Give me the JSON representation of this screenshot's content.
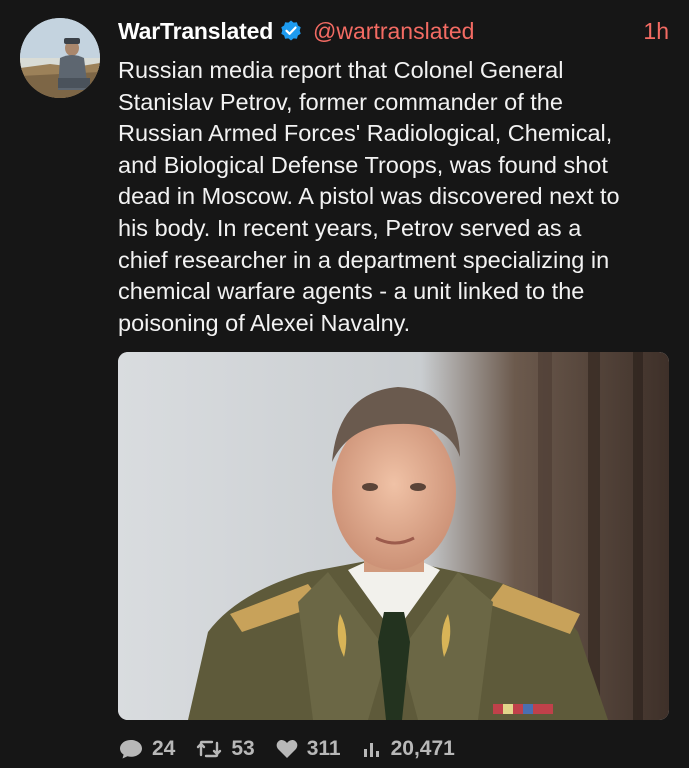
{
  "author": {
    "display_name": "WarTranslated",
    "handle": "@wartranslated",
    "verified": true,
    "avatar_icon": "profile-photo"
  },
  "timestamp": "1h",
  "tweet_text": "Russian media report that Colonel General\nStanislav Petrov, former commander of the\nRussian Armed Forces' Radiological, Chemical,\nand Biological Defense Troops, was found shot\ndead in Moscow. A pistol was discovered next to\nhis body. In recent years, Petrov served as a\nchief researcher in a department specializing in\nchemical warfare agents - a unit linked to the\npoisoning of Alexei Navalny.",
  "media": {
    "type": "photo",
    "icon": "portrait-photo"
  },
  "actions": {
    "replies": "24",
    "retweets": "53",
    "likes": "311",
    "views": "20,471"
  },
  "colors": {
    "background": "#161616",
    "accent": "#f36b63",
    "verified": "#1d9bf0",
    "text": "#f2f2f2",
    "muted": "#b8b8b8"
  }
}
